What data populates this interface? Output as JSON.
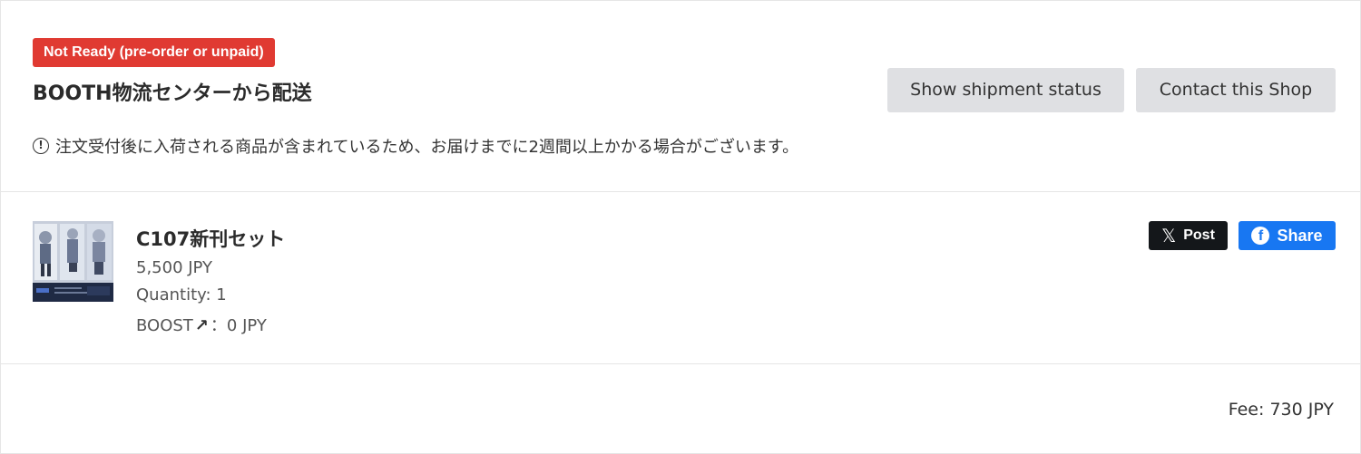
{
  "shipment": {
    "status_badge": "Not Ready (pre-order or unpaid)",
    "title": "BOOTH物流センターから配送",
    "show_status_label": "Show shipment status",
    "contact_label": "Contact this Shop",
    "notice": "注文受付後に入荷される商品が含まれているため、お届けまでに2週間以上かかる場合がございます。",
    "badge_color": "#e03a32"
  },
  "item": {
    "name": "C107新刊セット",
    "price": "5,500 JPY",
    "quantity_label": "Quantity:",
    "quantity": "1",
    "boost_label": "BOOST",
    "boost_value": "：0 JPY"
  },
  "share": {
    "x_label": "Post",
    "facebook_label": "Share",
    "facebook_color": "#1877f2"
  },
  "fee": {
    "label": "Fee:",
    "value": "730 JPY"
  }
}
